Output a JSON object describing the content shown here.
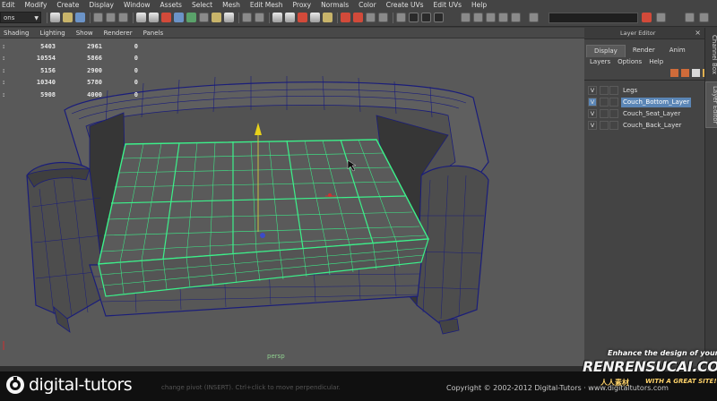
{
  "menubar": [
    "Edit",
    "Modify",
    "Create",
    "Display",
    "Window",
    "Assets",
    "Select",
    "Mesh",
    "Edit Mesh",
    "Proxy",
    "Normals",
    "Color",
    "Create UVs",
    "Edit UVs",
    "Help"
  ],
  "statusline": {
    "mode_value": "ons"
  },
  "viewport": {
    "menu": [
      "Shading",
      "Lighting",
      "Show",
      "Renderer",
      "Panels"
    ],
    "hud": [
      {
        "label": ":",
        "v1": "5403",
        "v2": "2961",
        "v3": "0"
      },
      {
        "label": ":",
        "v1": "10554",
        "v2": "5866",
        "v3": "0"
      },
      {
        "label": ":",
        "v1": "5156",
        "v2": "2900",
        "v3": "0"
      },
      {
        "label": ":",
        "v1": "10340",
        "v2": "5780",
        "v3": "0"
      },
      {
        "label": ":",
        "v1": "5908",
        "v2": "4000",
        "v3": "0"
      }
    ],
    "camera_label": "persp"
  },
  "layer_editor": {
    "title": "Layer Editor",
    "tabs": [
      "Display",
      "Render",
      "Anim"
    ],
    "active_tab": "Display",
    "submenu": [
      "Layers",
      "Options",
      "Help"
    ],
    "layers": [
      {
        "vis": "V",
        "name": "Legs",
        "selected": false
      },
      {
        "vis": "V",
        "name": "Couch_Bottom_Layer",
        "selected": true
      },
      {
        "vis": "V",
        "name": "Couch_Seat_Layer",
        "selected": false
      },
      {
        "vis": "V",
        "name": "Couch_Back_Layer",
        "selected": false
      }
    ]
  },
  "side_tabs": [
    "Channel Box",
    "Layer Editor"
  ],
  "footer": {
    "brand": "digital-tutors",
    "hint": "change pivot (INSERT). Ctrl+click to move perpendicular.",
    "copyright": "Copyright © 2002-2012 Digital-Tutors · www.digitaltutors.com"
  },
  "watermark": {
    "line1": "Enhance the design of your",
    "line2": "RENRENSUCAI.COM",
    "line3": "人人素材",
    "line4": "WITH A GREAT SITE!"
  },
  "colors": {
    "selection_wire": "#3cf08a",
    "object_wire": "#1a1d7a",
    "viewport_bg": "#595959",
    "layer_highlight": "#5b86b6"
  }
}
